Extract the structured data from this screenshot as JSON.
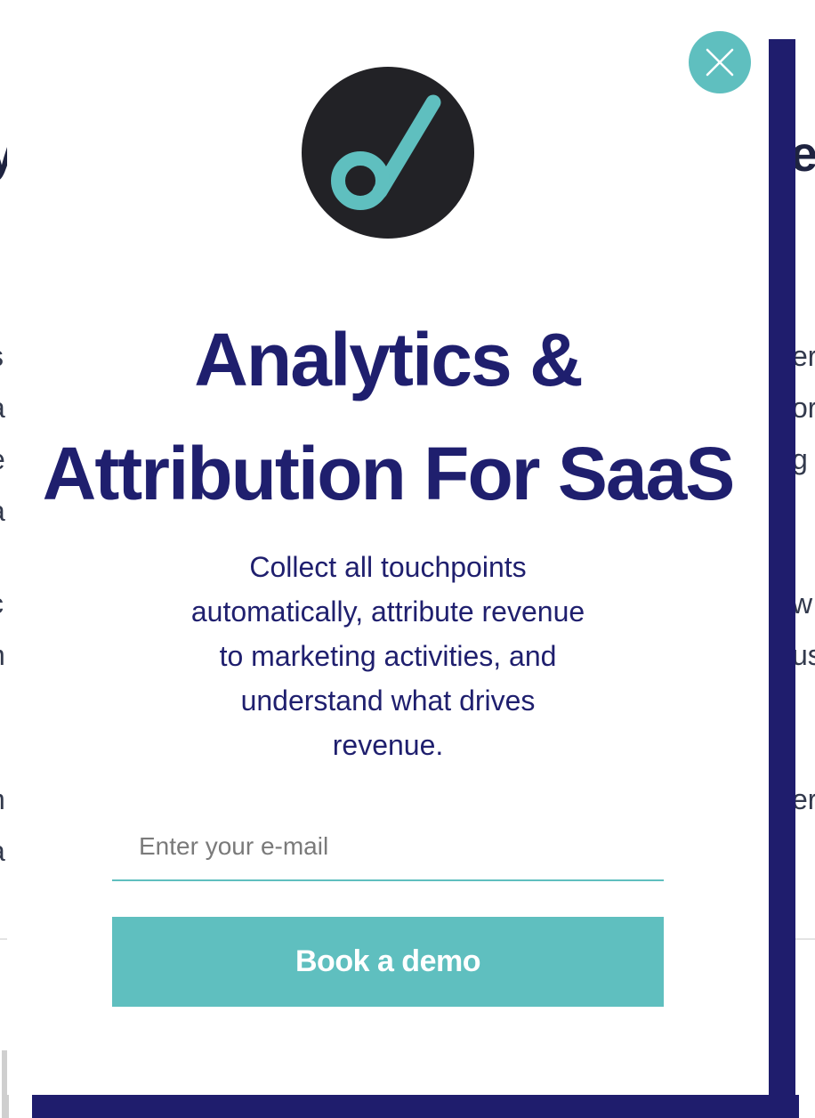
{
  "background_page": {
    "left_heading_fragment": "y",
    "right_heading_fragment": "e",
    "left_text_fragments": [
      "s",
      "a",
      "e",
      "a",
      "c",
      "n",
      "h",
      "a"
    ],
    "right_text_fragments": [
      "er",
      "or",
      "g",
      "w",
      "us",
      "er"
    ]
  },
  "modal": {
    "logo_icon": "attribution-app-logo-icon",
    "close_icon": "close-icon",
    "title_line_1": "Analytics &",
    "title_line_2": "Attribution For SaaS",
    "subtitle_line_1": "Collect all touchpoints",
    "subtitle_line_2": "automatically, attribute revenue",
    "subtitle_line_3": "to marketing activities, and",
    "subtitle_line_4": "understand what drives",
    "subtitle_line_5": "revenue.",
    "email_placeholder": "Enter your e-mail",
    "email_value": "",
    "cta_label": "Book a demo"
  },
  "colors": {
    "brand_navy": "#1f1f6e",
    "accent_teal": "#5fbfbf",
    "logo_bg": "#222226"
  }
}
